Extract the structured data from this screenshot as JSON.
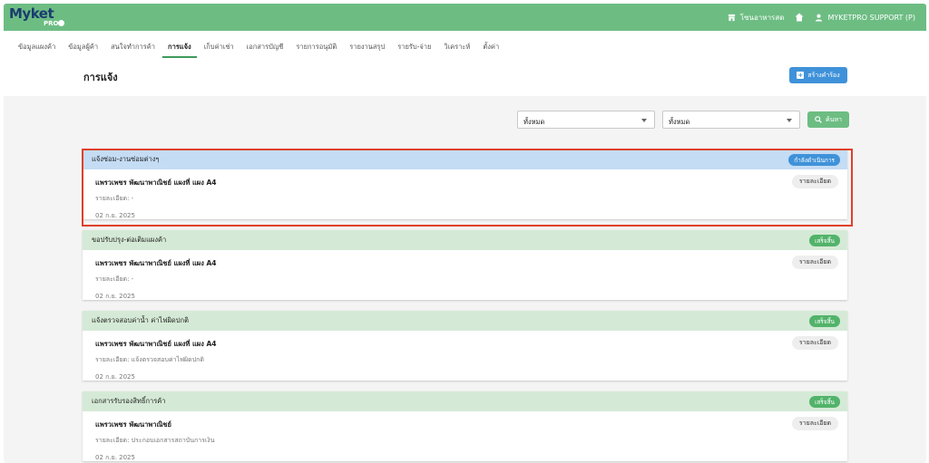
{
  "app": {
    "logo_text": "Myket",
    "logo_sub": "PRO",
    "topbar": {
      "shop_label": "โซนอาหารสด",
      "user_label": "MYKETPRO SUPPORT (P)"
    }
  },
  "nav": {
    "items": [
      {
        "label": "ข้อมูลแผงค้า",
        "active": false
      },
      {
        "label": "ข้อมูลผู้ค้า",
        "active": false
      },
      {
        "label": "สนใจทำการค้า",
        "active": false
      },
      {
        "label": "การแจ้ง",
        "active": true
      },
      {
        "label": "เก็บค่าเช่า",
        "active": false
      },
      {
        "label": "เอกสารบัญชี",
        "active": false
      },
      {
        "label": "รายการอนุมัติ",
        "active": false
      },
      {
        "label": "รายงานสรุป",
        "active": false
      },
      {
        "label": "รายรับ-จ่าย",
        "active": false
      },
      {
        "label": "วิเคราะห์",
        "active": false
      },
      {
        "label": "ตั้งค่า",
        "active": false
      }
    ]
  },
  "page": {
    "title": "การแจ้ง",
    "create_label": "สร้างคำร้อง"
  },
  "filters": {
    "select1": "ทั้งหมด",
    "select2": "ทั้งหมด",
    "search_label": "ค้นหา"
  },
  "cards": [
    {
      "header": "แจ้งซ่อม-งานซ่อมต่างๆ",
      "status": "กำลังดำเนินการ",
      "status_color": "#3f92d9",
      "title": "แพรวเพชร พัฒนาพาณิชย์ แผงที่ แผง A4",
      "detail": "รายละเอียด: -",
      "date": "02 ก.ย. 2025",
      "detail_button": "รายละเอียด"
    },
    {
      "header": "ขอปรับปรุง-ต่อเติมแผงค้า",
      "status": "เสร็จสิ้น",
      "status_color": "#52b36a",
      "title": "แพรวเพชร พัฒนาพาณิชย์ แผงที่ แผง A4",
      "detail": "รายละเอียด: -",
      "date": "02 ก.ย. 2025",
      "detail_button": "รายละเอียด"
    },
    {
      "header": "แจ้งตรวจสอบค่าน้ำ ค่าไฟผิดปกติ",
      "status": "เสร็จสิ้น",
      "status_color": "#52b36a",
      "title": "แพรวเพชร พัฒนาพาณิชย์ แผงที่ แผง A4",
      "detail": "รายละเอียด: แจ้งตรวจสอบค่าไฟผิดปกติ",
      "date": "02 ก.ย. 2025",
      "detail_button": "รายละเอียด"
    },
    {
      "header": "เอกสารรับรองสิทธิ์การค้า",
      "status": "เสร็จสิ้น",
      "status_color": "#52b36a",
      "title": "แพรวเพชร พัฒนาพาณิชย์",
      "detail": "รายละเอียด: ประกอบเอกสารสถาบันการเงิน",
      "date": "02 ก.ย. 2025",
      "detail_button": "รายละเอียด"
    }
  ],
  "colors": {
    "brand_green": "#6dbd83",
    "accent_blue": "#3f92d9",
    "highlight_red": "#e0402a"
  }
}
